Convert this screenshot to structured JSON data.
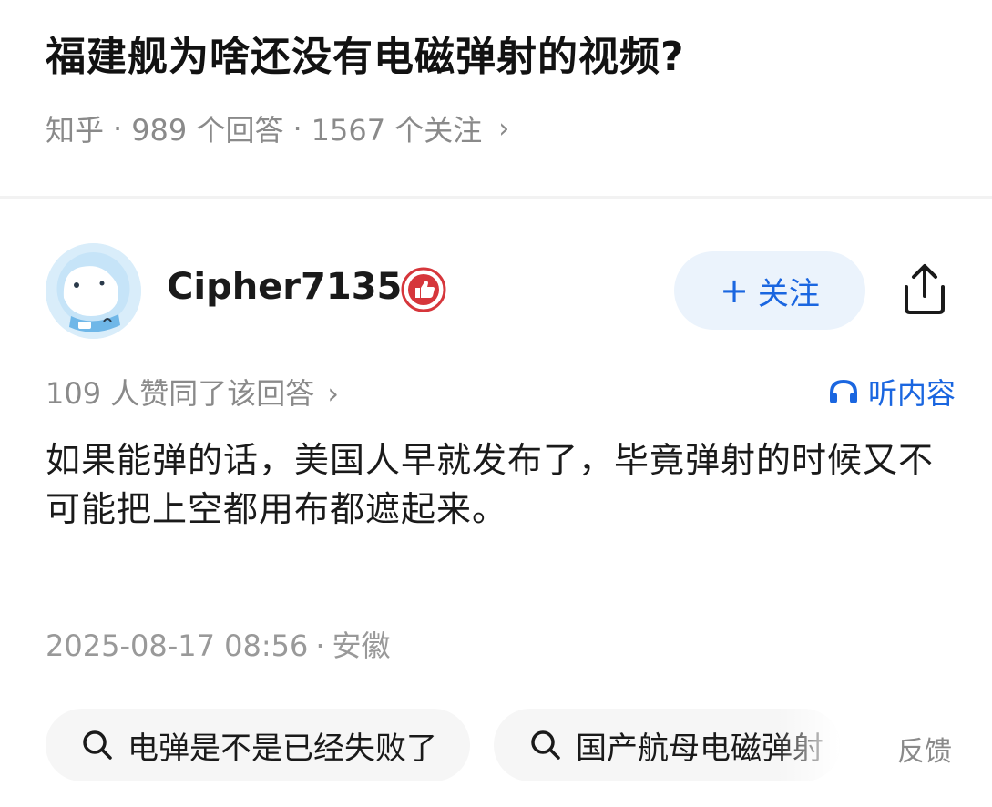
{
  "question": {
    "title": "福建舰为啥还没有电磁弹射的视频?",
    "source": "知乎",
    "answers": "989 个回答",
    "followers": "1567 个关注",
    "sep": "·",
    "chevron": "›"
  },
  "answer": {
    "author": "Cipher7135",
    "follow_label": "关注",
    "follow_plus": "+",
    "likes_text": "109 人赞同了该回答",
    "listen_label": "听内容",
    "body": "如果能弹的话，美国人早就发布了，毕竟弹射的时候又不可能把上空都用布都遮起来。",
    "date": "2025-08-17 08:56",
    "location": "安徽",
    "sep": "·"
  },
  "related_searches": [
    {
      "label": "电弹是不是已经失败了",
      "icon": "search-icon"
    },
    {
      "label": "国产航母电磁弹射",
      "icon": "search-icon"
    }
  ],
  "feedback_label": "反馈",
  "colors": {
    "accent": "#1a66e0",
    "follow_bg": "#ebf3fc",
    "muted_text": "#8a8a8a",
    "badge_red": "#d6363b"
  }
}
